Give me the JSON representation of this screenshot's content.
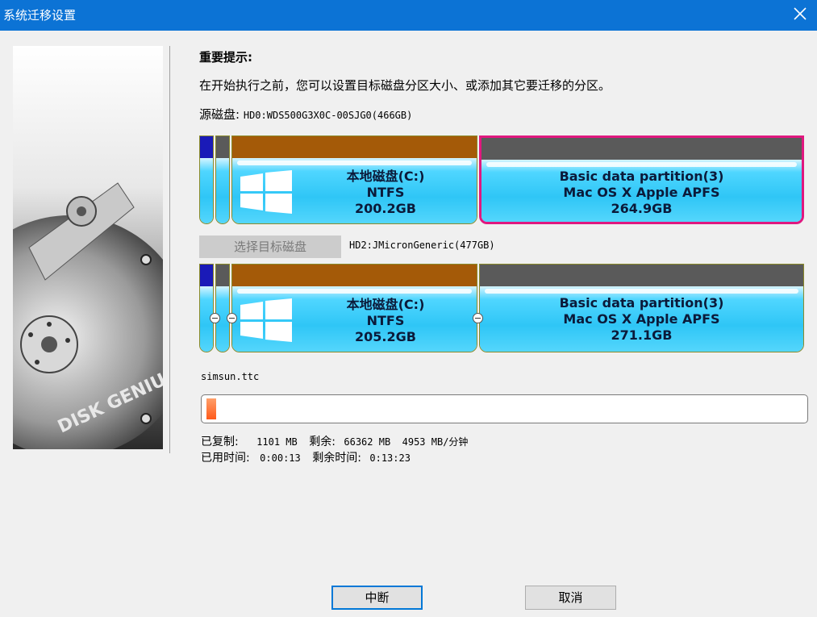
{
  "window": {
    "title": "系统迁移设置",
    "close_icon": "close-icon"
  },
  "hint": {
    "title": "重要提示:",
    "text": "在开始执行之前，您可以设置目标磁盘分区大小、或添加其它要迁移的分区。"
  },
  "source_disk": {
    "label": "源磁盘:",
    "name": "HD0:WDS500G3X0C-00SJG0(466GB)",
    "partitions": [
      {
        "name": "本地磁盘(C:)",
        "fs": "NTFS",
        "size": "200.2GB"
      },
      {
        "name": "Basic data partition(3)",
        "fs": "Mac OS X Apple APFS",
        "size": "264.9GB"
      }
    ]
  },
  "target": {
    "select_button": "选择目标磁盘",
    "name": "HD2:JMicronGeneric(477GB)",
    "partitions": [
      {
        "name": "本地磁盘(C:)",
        "fs": "NTFS",
        "size": "205.2GB"
      },
      {
        "name": "Basic data partition(3)",
        "fs": "Mac OS X Apple APFS",
        "size": "271.1GB"
      }
    ]
  },
  "progress": {
    "current_file": "simsun.ttc",
    "percent": 1.6,
    "copied_label": "已复制:",
    "copied_value": "1101 MB",
    "remaining_label": "剩余:",
    "remaining_value": "66362 MB",
    "speed": "4953 MB/分钟",
    "elapsed_label": "已用时间:",
    "elapsed_value": "0:00:13",
    "remaining_time_label": "剩余时间:",
    "remaining_time_value": "0:13:23"
  },
  "buttons": {
    "interrupt": "中断",
    "cancel": "取消"
  },
  "colors": {
    "titlebar": "#0c73d5",
    "selected_border": "#e0187f",
    "ntfs_bar": "#a45a08",
    "apfs_bar": "#5a5a5a"
  },
  "side_image_text": "DISK GENIUS"
}
